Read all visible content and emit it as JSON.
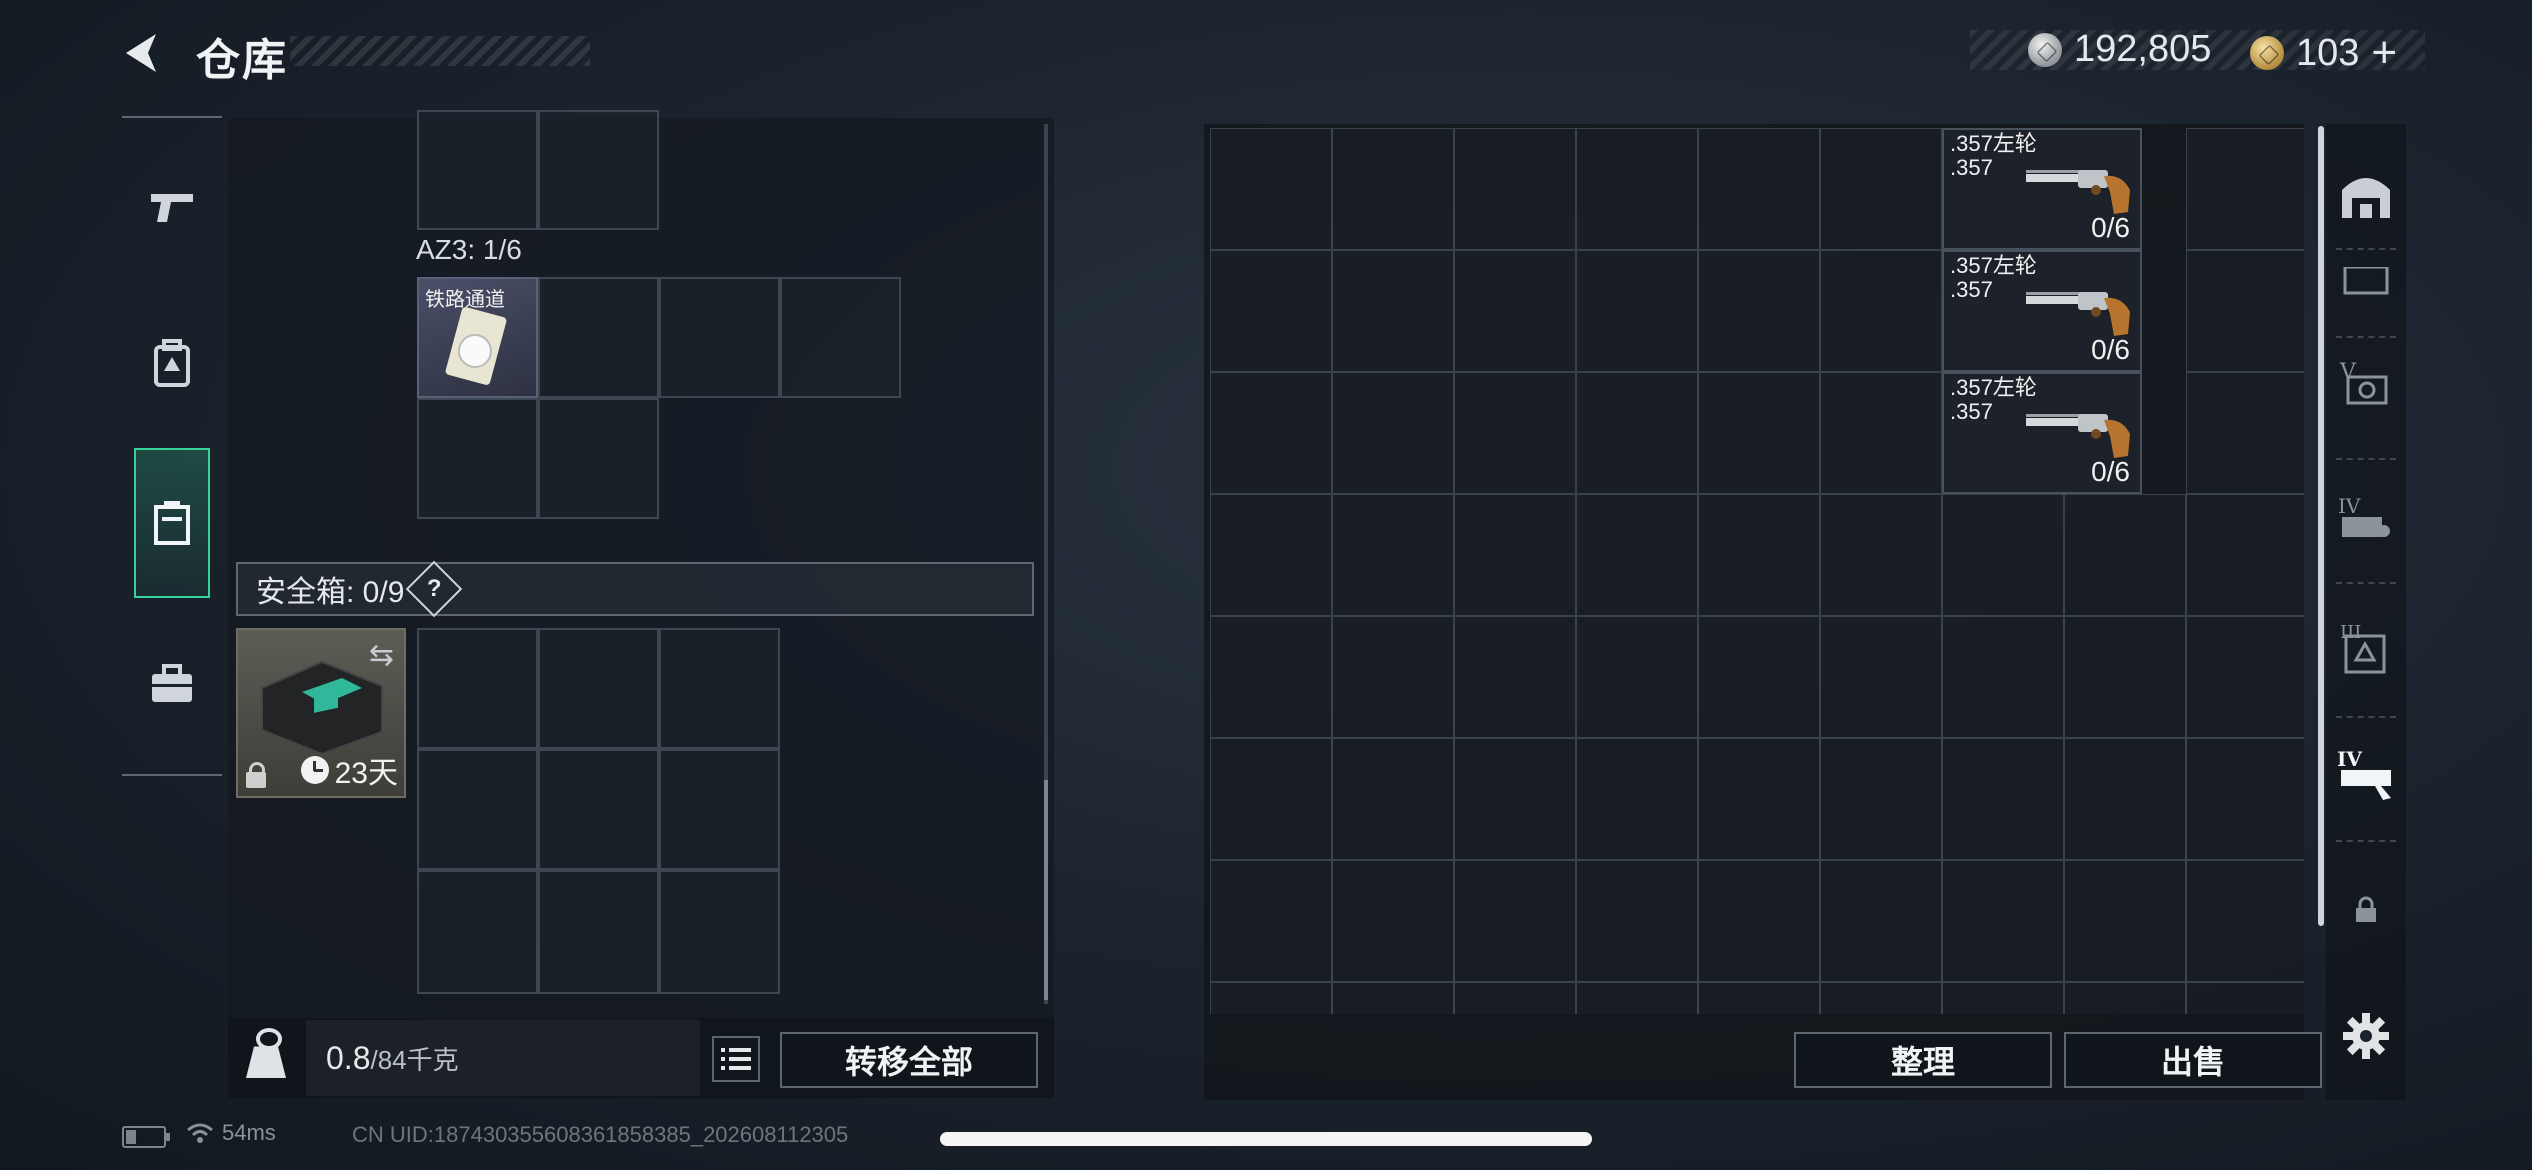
{
  "header": {
    "title": "仓库",
    "currency_silver": "192,805",
    "currency_gold": "103",
    "currency_gold_add": "+"
  },
  "left_nav": {
    "items": [
      {
        "name": "weapon",
        "icon": "pistol-icon"
      },
      {
        "name": "backpack",
        "icon": "backpack-icon"
      },
      {
        "name": "container",
        "icon": "container-icon",
        "active": true
      },
      {
        "name": "toolbox",
        "icon": "briefcase-icon"
      }
    ]
  },
  "container": {
    "az3_label": "AZ3: 1/6",
    "item_name": "铁路通道",
    "safe_box_label": "安全箱: 0/9",
    "help": "?",
    "safe_box_days": "23天"
  },
  "weight": {
    "current": "0.8",
    "max": "/84千克"
  },
  "buttons": {
    "transfer_all": "转移全部",
    "sort": "整理",
    "sell": "出售"
  },
  "stash": {
    "guns": [
      {
        "name": ".357左轮",
        "caliber": ".357",
        "ammo": "0/6"
      },
      {
        "name": ".357左轮",
        "caliber": ".357",
        "ammo": "0/6"
      },
      {
        "name": ".357左轮",
        "caliber": ".357",
        "ammo": "0/6"
      }
    ]
  },
  "status": {
    "ping": "54ms",
    "uid": "CN UID:18743035560836185838​5_202608112305"
  },
  "colors": {
    "accent": "#38d39b",
    "panel": "#141a21"
  }
}
